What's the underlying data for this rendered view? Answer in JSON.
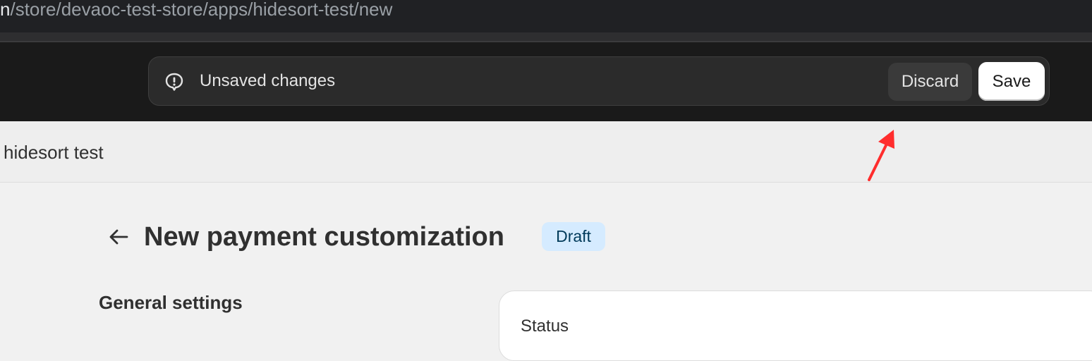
{
  "browser": {
    "url_prefix": "n",
    "url_path": "/store/devaoc-test-store/apps/hidesort-test/new"
  },
  "save_bar": {
    "message": "Unsaved changes",
    "discard_label": "Discard",
    "save_label": "Save"
  },
  "app_header": {
    "app_name": "hidesort test"
  },
  "page": {
    "title": "New payment customization",
    "badge": "Draft"
  },
  "general_settings": {
    "heading": "General settings",
    "status_label": "Status"
  },
  "colors": {
    "top_bar_bg": "#1a1a1a",
    "badge_bg": "#d5ebff",
    "annotation_arrow": "#ff2d2d"
  },
  "icons": {
    "alert": "alert-bubble-icon",
    "back": "arrow-left-icon",
    "annotation": "red-pointer-arrow"
  }
}
